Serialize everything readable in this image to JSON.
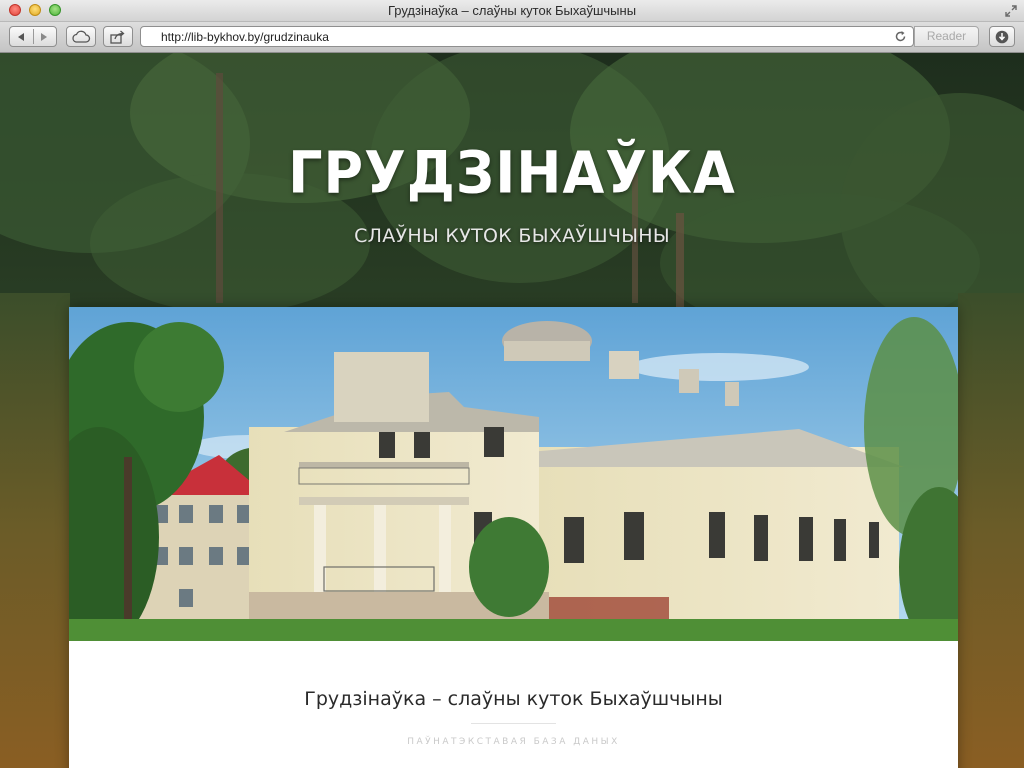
{
  "window": {
    "title": "Грудзінаўка – слаўны куток Быхаўшчыны"
  },
  "toolbar": {
    "url": "http://lib-bykhov.by/grudzinauka",
    "reader_label": "Reader",
    "icons": [
      "back-icon",
      "forward-icon",
      "icloud-icon",
      "share-icon",
      "reload-icon",
      "downloads-icon"
    ]
  },
  "site": {
    "title": "ГРУДЗІНАЎКА",
    "subtitle": "СЛАЎНЫ КУТОК БЫХАЎШЧЫНЫ"
  },
  "post": {
    "title": "Грудзінаўка – слаўны куток Быхаўшчыны",
    "category": "ПАЎНАТЭКСТАВАЯ БАЗА ДАНЫХ"
  },
  "colors": {
    "accent_roof": "#c8303a",
    "sky": "#8ec3e6",
    "forest": "#2f4a28"
  }
}
